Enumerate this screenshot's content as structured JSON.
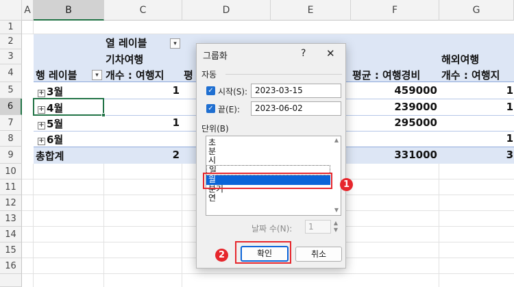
{
  "columns": [
    "A",
    "B",
    "C",
    "D",
    "E",
    "F",
    "G"
  ],
  "rows": [
    "1",
    "2",
    "3",
    "4",
    "5",
    "6",
    "7",
    "8",
    "9",
    "10",
    "11",
    "12",
    "13",
    "14",
    "15",
    "16"
  ],
  "pivot": {
    "col_labels_header": "열 레이블",
    "train_trip": "기차여행",
    "overseas_trip": "해외여행",
    "row_labels_header": "행 레이블",
    "count_dest": "개수 : 여행지",
    "count_dest_g": "개수 : 여행지",
    "avg_partial": "평",
    "avg_cost": "평균 : 여행경비",
    "rows": [
      {
        "label": "3월",
        "c": "1",
        "f": "459000",
        "g": "1"
      },
      {
        "label": "4월",
        "c": "",
        "f": "239000",
        "g": "1"
      },
      {
        "label": "5월",
        "c": "1",
        "f": "295000",
        "g": ""
      },
      {
        "label": "6월",
        "c": "",
        "f": "",
        "g": "1"
      }
    ],
    "total_label": "총합계",
    "total_c": "2",
    "total_f": "331000",
    "total_g": "3"
  },
  "dialog": {
    "title": "그룹화",
    "help": "?",
    "close": "✕",
    "auto_label": "자동",
    "start_label": "시작(S):",
    "start_value": "2023-03-15",
    "end_label": "끝(E):",
    "end_value": "2023-06-02",
    "unit_label": "단위(B)",
    "units": [
      "초",
      "분",
      "시",
      "일",
      "월",
      "분기",
      "연"
    ],
    "selected_unit": "월",
    "days_label": "날짜 수(N):",
    "days_value": "1",
    "ok": "확인",
    "cancel": "취소"
  },
  "badges": {
    "one": "1",
    "two": "2"
  },
  "colors": {
    "accent": "#217346",
    "highlight": "#0a64d8",
    "callout": "#e6262c",
    "band": "#dde6f5"
  }
}
